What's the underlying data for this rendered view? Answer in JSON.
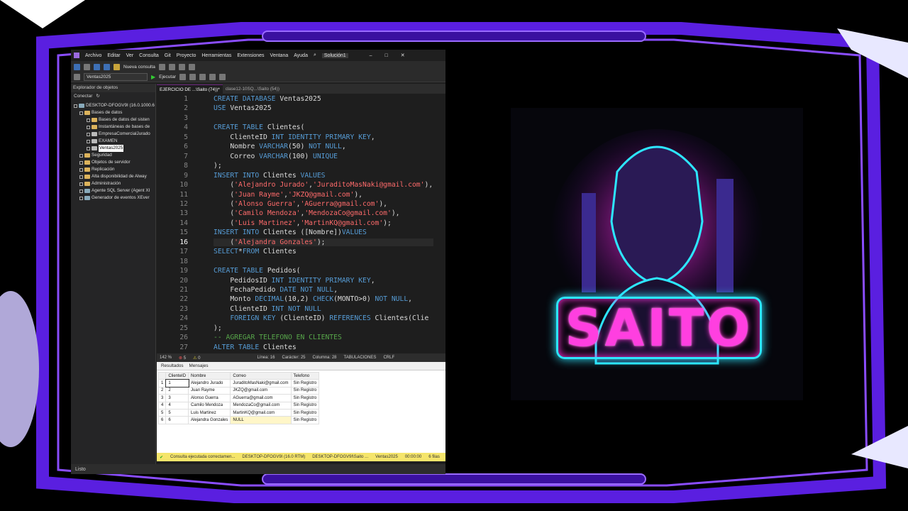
{
  "menu": [
    "Archivo",
    "Editar",
    "Ver",
    "Consulta",
    "Git",
    "Proyecto",
    "Herramientas",
    "Extensiones",
    "Ventana",
    "Ayuda"
  ],
  "solution": "Solución1",
  "toolbar": {
    "new_query": "Nueva consulta",
    "database": "Ventas2025",
    "execute": "Ejecutar"
  },
  "explorer": {
    "title": "Explorador de objetos",
    "connect": "Conectar",
    "server": "DESKTOP-DFOGV9I (16.0.1000.6",
    "nodes": [
      "Bases de datos",
      "Bases de datos del sisten",
      "Instantáneas de bases de",
      "EmpresaComercialJurado",
      "EXAMEN",
      "Ventas2025",
      "Seguridad",
      "Objetos de servidor",
      "Replicación",
      "Alta disponibilidad de Alway",
      "Administración",
      "Agente SQL Server (Agent XI",
      "Generador de eventos XEver"
    ]
  },
  "tabs": [
    "EJERCICIO DE ...\\Saito (74))*",
    "clase12-10SQ...\\Saito (54))"
  ],
  "code_lines": [
    {
      "n": "1",
      "t": "CREATE DATABASE Ventas2025"
    },
    {
      "n": "2",
      "t": "USE Ventas2025"
    },
    {
      "n": "3",
      "t": ""
    },
    {
      "n": "4",
      "t": "CREATE TABLE Clientes("
    },
    {
      "n": "5",
      "t": "    ClienteID INT IDENTITY PRIMARY KEY,"
    },
    {
      "n": "6",
      "t": "    Nombre VARCHAR(50) NOT NULL,"
    },
    {
      "n": "7",
      "t": "    Correo VARCHAR(100) UNIQUE"
    },
    {
      "n": "8",
      "t": ");"
    },
    {
      "n": "9",
      "t": "INSERT INTO Clientes VALUES"
    },
    {
      "n": "10",
      "t": "    ('Alejandro Jurado','JuraditoMasNaki@gmail.com'),"
    },
    {
      "n": "11",
      "t": "    ('Juan Rayme','JKZQ@gmail.com'),"
    },
    {
      "n": "12",
      "t": "    ('Alonso Guerra','AGuerra@gmail.com'),"
    },
    {
      "n": "13",
      "t": "    ('Camilo Mendoza','MendozaCo@gmail.com'),"
    },
    {
      "n": "14",
      "t": "    ('Luis Martinez','MartinKQ@gmail.com');"
    },
    {
      "n": "15",
      "t": "INSERT INTO Clientes ([Nombre])VALUES"
    },
    {
      "n": "16",
      "t": "    ('Alejandra Gonzales');"
    },
    {
      "n": "17",
      "t": "SELECT*FROM Clientes"
    },
    {
      "n": "18",
      "t": ""
    },
    {
      "n": "19",
      "t": "CREATE TABLE Pedidos("
    },
    {
      "n": "20",
      "t": "    PedidosID INT IDENTITY PRIMARY KEY,"
    },
    {
      "n": "21",
      "t": "    FechaPedido DATE NOT NULL,"
    },
    {
      "n": "22",
      "t": "    Monto DECIMAL(10,2) CHECK(MONTO>0) NOT NULL,"
    },
    {
      "n": "23",
      "t": "    ClienteID INT NOT NULL"
    },
    {
      "n": "24",
      "t": "    FOREIGN KEY (ClienteID) REFERENCES Clientes(Clie"
    },
    {
      "n": "25",
      "t": ");"
    },
    {
      "n": "26",
      "t": "-- AGREGAR TELEFONO EN CLIENTES"
    },
    {
      "n": "27",
      "t": "ALTER TABLE Clientes"
    }
  ],
  "status": {
    "zoom": "142 %",
    "errors": "5",
    "warnings": "0",
    "line": "Línea: 16",
    "char": "Carácter: 25",
    "col": "Columna: 28",
    "tabs": "TABULACIONES",
    "eol": "CRLF"
  },
  "results": {
    "tab_results": "Resultados",
    "tab_messages": "Mensajes",
    "headers": [
      "",
      "ClienteID",
      "Nombre",
      "Correo",
      "Telefono"
    ],
    "rows": [
      [
        "1",
        "1",
        "Alejandro Jurado",
        "JuraditoMasNaki@gmail.com",
        "Sin Registro"
      ],
      [
        "2",
        "2",
        "Juan Rayme",
        "JKZQ@gmail.com",
        "Sin Registro"
      ],
      [
        "3",
        "3",
        "Alonso Guerra",
        "AGuerra@gmail.com",
        "Sin Registro"
      ],
      [
        "4",
        "4",
        "Camilo Mendoza",
        "MendozaCo@gmail.com",
        "Sin Registro"
      ],
      [
        "5",
        "5",
        "Luis Martinez",
        "MartinKQ@gmail.com",
        "Sin Registro"
      ],
      [
        "6",
        "6",
        "Alejandra Gonzales",
        "NULL",
        "Sin Registro"
      ]
    ]
  },
  "query_status": {
    "msg": "Consulta ejecutada correctamen...",
    "server": "DESKTOP-DFOGV9I (16.0 RTM)",
    "user": "DESKTOP-DFOGV9I\\Saito ...",
    "db": "Ventas2025",
    "time": "00:00:00",
    "rows": "6 filas"
  },
  "ready": "Listo",
  "brand": "SAITO",
  "colors": {
    "frame": "#6a2cff",
    "neon_cyan": "#2de6ff",
    "neon_pink": "#ff2bd6"
  }
}
